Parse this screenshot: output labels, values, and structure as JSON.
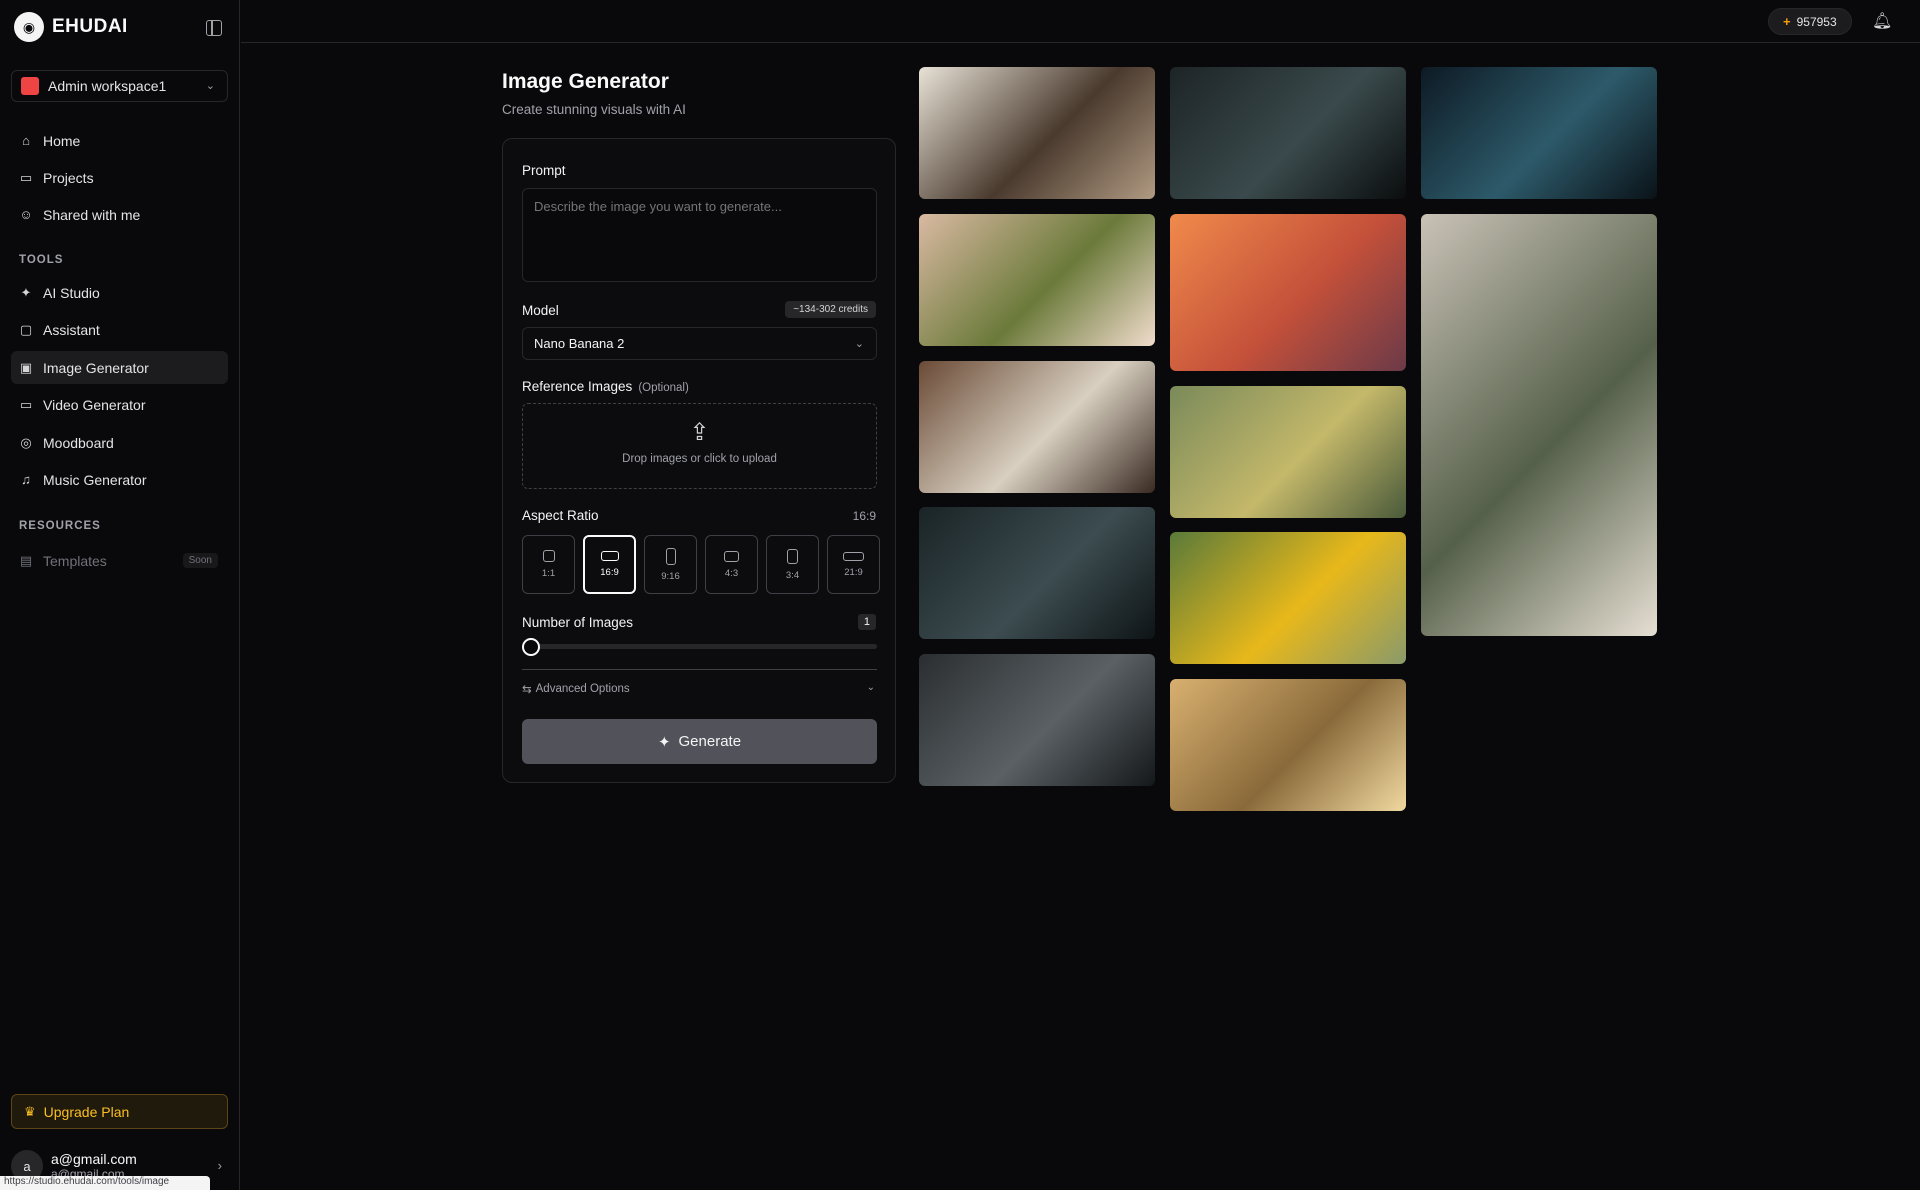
{
  "brand": {
    "name": "EHUDAI",
    "logo": "ehudai-logo-icon"
  },
  "workspace": {
    "name": "Admin workspace1",
    "color": "#ef4444"
  },
  "nav": [
    {
      "label": "Home",
      "icon": "home-icon"
    },
    {
      "label": "Projects",
      "icon": "folder-icon"
    },
    {
      "label": "Shared with me",
      "icon": "users-icon"
    }
  ],
  "tools_label": "TOOLS",
  "tools": [
    {
      "label": "AI Studio",
      "icon": "sparkles-icon"
    },
    {
      "label": "Assistant",
      "icon": "chat-icon"
    },
    {
      "label": "Image Generator",
      "icon": "image-icon",
      "active": true
    },
    {
      "label": "Video Generator",
      "icon": "video-icon"
    },
    {
      "label": "Moodboard",
      "icon": "palette-icon"
    },
    {
      "label": "Music Generator",
      "icon": "music-icon"
    }
  ],
  "resources_label": "RESOURCES",
  "resources": [
    {
      "label": "Templates",
      "icon": "template-icon",
      "badge": "Soon"
    }
  ],
  "upgrade_label": "Upgrade Plan",
  "user": {
    "avatar_letter": "a",
    "name": "a@gmail.com",
    "email": "a@gmail.com"
  },
  "status_url": "https://studio.ehudai.com/tools/image",
  "topbar": {
    "credits": "957953"
  },
  "page": {
    "title": "Image Generator",
    "subtitle": "Create stunning visuals with AI"
  },
  "form": {
    "prompt_label": "Prompt",
    "prompt_placeholder": "Describe the image you want to generate...",
    "model_label": "Model",
    "model_credits": "~134-302 credits",
    "model_value": "Nano Banana 2",
    "ref_label": "Reference Images",
    "ref_optional": "(Optional)",
    "ref_drop_text": "Drop images or click to upload",
    "aspect_label": "Aspect Ratio",
    "aspect_value": "16:9",
    "ratios": [
      "1:1",
      "16:9",
      "9:16",
      "4:3",
      "3:4",
      "21:9"
    ],
    "num_label": "Number of Images",
    "num_value": "1",
    "advanced_label": "Advanced Options",
    "generate_label": "Generate"
  },
  "gallery": [
    {
      "name": "coffee-ceremony-image",
      "colors": [
        "#e8e2d6",
        "#4a3a2e",
        "#b09a82"
      ]
    },
    {
      "name": "film-strip-image",
      "colors": [
        "#1d2426",
        "#3a4a4c",
        "#0a0d0e"
      ]
    },
    {
      "name": "fantasy-city-image",
      "colors": [
        "#0d1a24",
        "#2d5a6a",
        "#0a1218"
      ]
    },
    {
      "name": "eye-closeup-image",
      "colors": [
        "#d9b9a2",
        "#6b7a3a",
        "#f0dccc"
      ]
    },
    {
      "name": "beach-sunset-image",
      "colors": [
        "#f08a4b",
        "#c4503a",
        "#6b3a48"
      ]
    },
    {
      "name": "architect-desk-image",
      "colors": [
        "#c9c2b6",
        "#55604a",
        "#e6dfd3"
      ]
    },
    {
      "name": "coffee-ceremony-wide-image",
      "colors": [
        "#6a4a36",
        "#d8cfc0",
        "#3a2a22"
      ]
    },
    {
      "name": "ethiopia-collage-image",
      "colors": [
        "#7a8a5a",
        "#c4b86a",
        "#4a5a3a"
      ]
    },
    {
      "name": "cinematic-grid-image",
      "colors": [
        "#1a2426",
        "#3c4c50",
        "#0e1416"
      ]
    },
    {
      "name": "school-bus-image",
      "colors": [
        "#5a7a3a",
        "#e8b81a",
        "#8a9a6a"
      ]
    },
    {
      "name": "portrait-grid-image",
      "colors": [
        "#2a2e30",
        "#5a6064",
        "#14181a"
      ]
    },
    {
      "name": "canyon-meditation-image",
      "colors": [
        "#d8b070",
        "#8a6a3a",
        "#f0d8a0"
      ]
    }
  ]
}
